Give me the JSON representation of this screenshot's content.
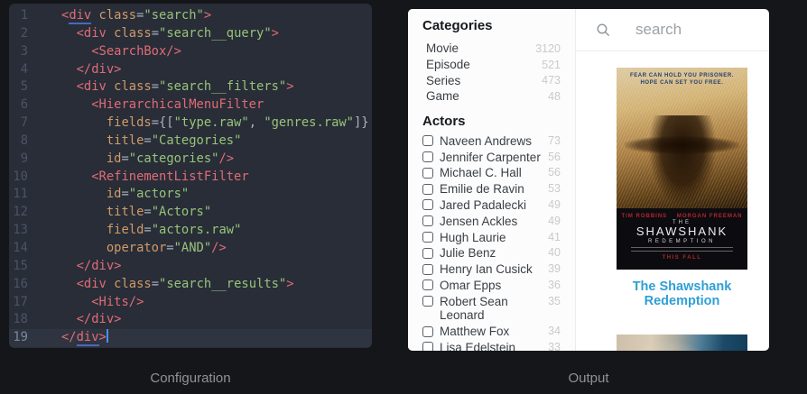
{
  "captions": {
    "left": "Configuration",
    "right": "Output"
  },
  "editor": {
    "active_line": 19,
    "lines": [
      {
        "n": 1,
        "tokens": [
          [
            "t",
            "<"
          ],
          [
            "u",
            "div"
          ],
          [
            "d",
            " "
          ],
          [
            "a",
            "class"
          ],
          [
            "d",
            "="
          ],
          [
            "s",
            "\"search\""
          ],
          [
            "t",
            ">"
          ]
        ]
      },
      {
        "n": 2,
        "tokens": [
          [
            "d",
            "  "
          ],
          [
            "t",
            "<div"
          ],
          [
            "d",
            " "
          ],
          [
            "a",
            "class"
          ],
          [
            "d",
            "="
          ],
          [
            "s",
            "\"search__query\""
          ],
          [
            "t",
            ">"
          ]
        ]
      },
      {
        "n": 3,
        "tokens": [
          [
            "d",
            "    "
          ],
          [
            "t",
            "<SearchBox/>"
          ]
        ]
      },
      {
        "n": 4,
        "tokens": [
          [
            "d",
            "  "
          ],
          [
            "t",
            "</div>"
          ]
        ]
      },
      {
        "n": 5,
        "tokens": [
          [
            "d",
            "  "
          ],
          [
            "t",
            "<div"
          ],
          [
            "d",
            " "
          ],
          [
            "a",
            "class"
          ],
          [
            "d",
            "="
          ],
          [
            "s",
            "\"search__filters\""
          ],
          [
            "t",
            ">"
          ]
        ]
      },
      {
        "n": 6,
        "tokens": [
          [
            "d",
            "    "
          ],
          [
            "t",
            "<HierarchicalMenuFilter"
          ]
        ]
      },
      {
        "n": 7,
        "tokens": [
          [
            "d",
            "      "
          ],
          [
            "a",
            "fields"
          ],
          [
            "d",
            "={["
          ],
          [
            "s",
            "\"type.raw\""
          ],
          [
            "d",
            ", "
          ],
          [
            "s",
            "\"genres.raw\""
          ],
          [
            "d",
            "]}"
          ]
        ]
      },
      {
        "n": 8,
        "tokens": [
          [
            "d",
            "      "
          ],
          [
            "a",
            "title"
          ],
          [
            "d",
            "="
          ],
          [
            "s",
            "\"Categories\""
          ]
        ]
      },
      {
        "n": 9,
        "tokens": [
          [
            "d",
            "      "
          ],
          [
            "a",
            "id"
          ],
          [
            "d",
            "="
          ],
          [
            "s",
            "\"categories\""
          ],
          [
            "t",
            "/>"
          ]
        ]
      },
      {
        "n": 10,
        "tokens": [
          [
            "d",
            "    "
          ],
          [
            "t",
            "<RefinementListFilter"
          ]
        ]
      },
      {
        "n": 11,
        "tokens": [
          [
            "d",
            "      "
          ],
          [
            "a",
            "id"
          ],
          [
            "d",
            "="
          ],
          [
            "s",
            "\"actors\""
          ]
        ]
      },
      {
        "n": 12,
        "tokens": [
          [
            "d",
            "      "
          ],
          [
            "a",
            "title"
          ],
          [
            "d",
            "="
          ],
          [
            "s",
            "\"Actors\""
          ]
        ]
      },
      {
        "n": 13,
        "tokens": [
          [
            "d",
            "      "
          ],
          [
            "a",
            "field"
          ],
          [
            "d",
            "="
          ],
          [
            "s",
            "\"actors.raw\""
          ]
        ]
      },
      {
        "n": 14,
        "tokens": [
          [
            "d",
            "      "
          ],
          [
            "a",
            "operator"
          ],
          [
            "d",
            "="
          ],
          [
            "s",
            "\"AND\""
          ],
          [
            "t",
            "/>"
          ]
        ]
      },
      {
        "n": 15,
        "tokens": [
          [
            "d",
            "  "
          ],
          [
            "t",
            "</div>"
          ]
        ]
      },
      {
        "n": 16,
        "tokens": [
          [
            "d",
            "  "
          ],
          [
            "t",
            "<div"
          ],
          [
            "d",
            " "
          ],
          [
            "a",
            "class"
          ],
          [
            "d",
            "="
          ],
          [
            "s",
            "\"search__results\""
          ],
          [
            "t",
            ">"
          ]
        ]
      },
      {
        "n": 17,
        "tokens": [
          [
            "d",
            "    "
          ],
          [
            "t",
            "<Hits/>"
          ]
        ]
      },
      {
        "n": 18,
        "tokens": [
          [
            "d",
            "  "
          ],
          [
            "t",
            "</div>"
          ]
        ]
      },
      {
        "n": 19,
        "tokens": [
          [
            "t",
            "</"
          ],
          [
            "u",
            "div"
          ],
          [
            "t",
            ">"
          ],
          [
            "c",
            ""
          ]
        ]
      }
    ]
  },
  "output": {
    "search": {
      "placeholder": "search",
      "icon": "magnifier"
    },
    "facets": {
      "categories": {
        "title": "Categories",
        "items": [
          {
            "label": "Movie",
            "count": "3120"
          },
          {
            "label": "Episode",
            "count": "521"
          },
          {
            "label": "Series",
            "count": "473"
          },
          {
            "label": "Game",
            "count": "48"
          }
        ]
      },
      "actors": {
        "title": "Actors",
        "items": [
          {
            "label": "Naveen Andrews",
            "count": "73"
          },
          {
            "label": "Jennifer Carpenter",
            "count": "56"
          },
          {
            "label": "Michael C. Hall",
            "count": "56"
          },
          {
            "label": "Emilie de Ravin",
            "count": "53"
          },
          {
            "label": "Jared Padalecki",
            "count": "49"
          },
          {
            "label": "Jensen Ackles",
            "count": "49"
          },
          {
            "label": "Hugh Laurie",
            "count": "41"
          },
          {
            "label": "Julie Benz",
            "count": "40"
          },
          {
            "label": "Henry Ian Cusick",
            "count": "39"
          },
          {
            "label": "Omar Epps",
            "count": "36"
          },
          {
            "label": "Robert Sean Leonard",
            "count": "35"
          },
          {
            "label": "Matthew Fox",
            "count": "34"
          },
          {
            "label": "Lisa Edelstein",
            "count": "33"
          }
        ]
      }
    },
    "results": {
      "hit_title": "The Shawshank Redemption",
      "poster": {
        "tagline_line1": "FEAR CAN HOLD YOU PRISONER.",
        "tagline_line2": "HOPE CAN SET YOU FREE.",
        "stars": "TIM ROBBINS    MORGAN FREEMAN",
        "title_prefix": "THE",
        "title": "SHAWSHANK",
        "subtitle": "REDEMPTION",
        "release": "THIS FALL"
      }
    }
  },
  "colors": {
    "link_blue": "#2f9fd6",
    "code_tag": "#e06c75",
    "code_attr": "#d19a66",
    "code_string": "#98c379",
    "editor_bg": "#282d38",
    "page_bg": "#15161a"
  }
}
